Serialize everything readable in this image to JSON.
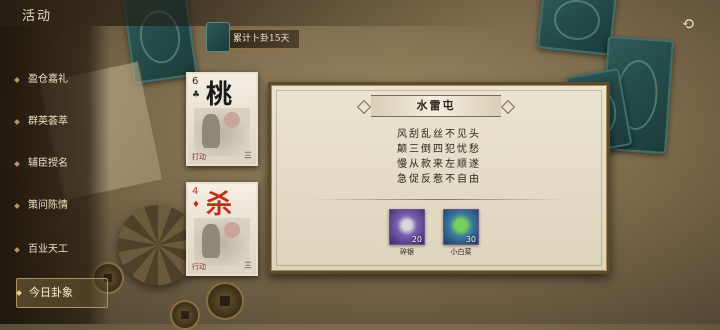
{
  "header": {
    "title": "活动",
    "back_icon": "back-arrow-icon"
  },
  "counter": {
    "text": "累计卜卦15天"
  },
  "sidebar": {
    "items": [
      {
        "label": "盈仓嘉礼",
        "active": false
      },
      {
        "label": "群英荟萃",
        "active": false
      },
      {
        "label": "辅臣授名",
        "active": false
      },
      {
        "label": "策问陈情",
        "active": false
      },
      {
        "label": "百业天工",
        "active": false
      },
      {
        "label": "今日卦象",
        "active": true
      }
    ]
  },
  "cards": [
    {
      "number": "6",
      "glyph": "桃",
      "suit": "club",
      "tag": "打动",
      "mark": "三"
    },
    {
      "number": "4",
      "glyph": "杀",
      "suit": "diamond",
      "tag": "行动",
      "mark": "三",
      "red": true
    }
  ],
  "panel": {
    "hexagram_title": "水雷屯",
    "poem": [
      "风刮乱丝不见头",
      "颠三倒四犯忧愁",
      "慢从款来左顺遂",
      "急促反惹不自由"
    ],
    "rewards": [
      {
        "name": "碎银",
        "count": "20",
        "icon": "silver-ingot-icon"
      },
      {
        "name": "小白菜",
        "count": "30",
        "icon": "cabbage-icon"
      }
    ]
  },
  "colors": {
    "accent_gold": "#b09260",
    "panel_bg": "#ebe4d2",
    "teal_card": "#2f5a57"
  }
}
